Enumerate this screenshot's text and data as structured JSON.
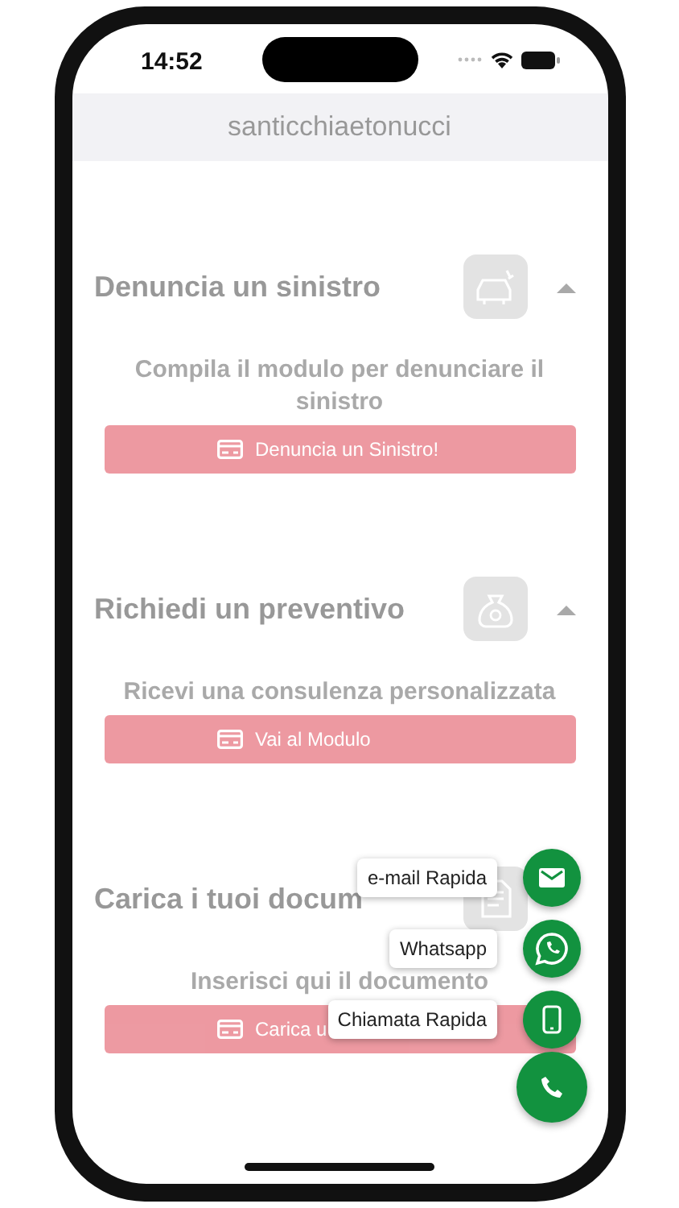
{
  "status_bar": {
    "time": "14:52"
  },
  "header": {
    "title": "santicchiaetonucci"
  },
  "sections": [
    {
      "title": "Denuncia un sinistro",
      "expanded": true,
      "description": "Compila il modulo per denunciare il sinistro",
      "button": "Denuncia un Sinistro!"
    },
    {
      "title": "Richiedi un preventivo",
      "expanded": true,
      "description": "Ricevi una consulenza personalizzata",
      "button": "Vai al Modulo"
    },
    {
      "title": "Carica i tuoi docum",
      "description": "Inserisci qui il documento",
      "button": "Carica u"
    }
  ],
  "fab_menu": {
    "open": true,
    "items": [
      {
        "label": "e-mail Rapida",
        "kind": "email"
      },
      {
        "label": "Whatsapp",
        "kind": "whatsapp"
      },
      {
        "label": "Chiamata Rapida",
        "kind": "mobile"
      }
    ]
  }
}
